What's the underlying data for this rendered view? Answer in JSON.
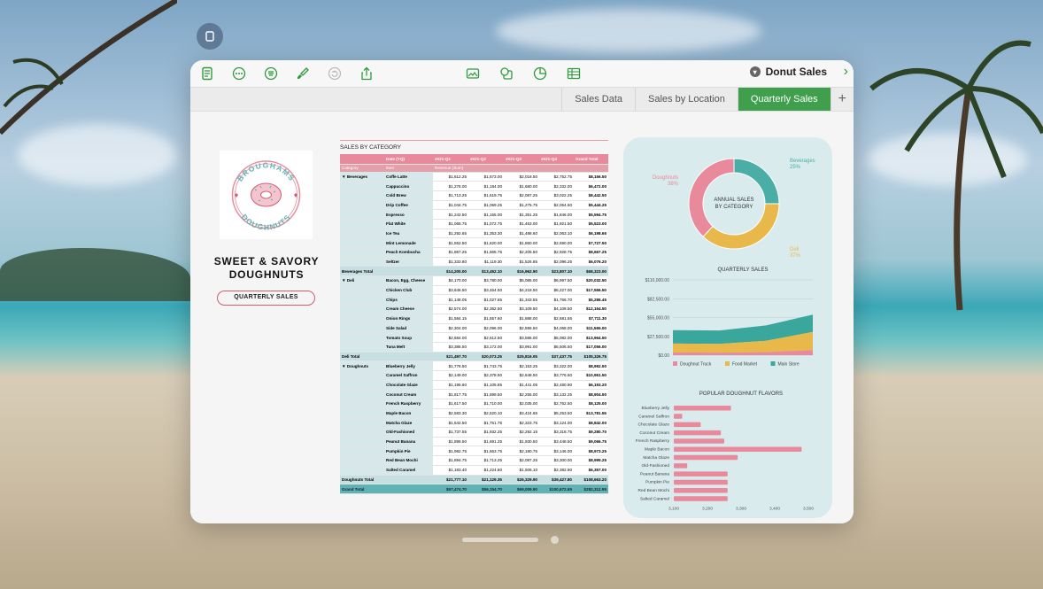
{
  "window": {
    "doc_title": "Donut Sales",
    "tabs": [
      "Sales Data",
      "Sales by Location",
      "Quarterly Sales"
    ],
    "active_tab": "Quarterly Sales",
    "accent_color": "#3f9f4c"
  },
  "toolbar_icons": [
    "document-icon",
    "more-icon",
    "format-icon",
    "brush-icon",
    "undo-icon",
    "share-icon"
  ],
  "insert_icons": [
    "media-icon",
    "shape-icon",
    "chart-icon",
    "table-icon"
  ],
  "logo": {
    "top": "BROUGHAMS",
    "bottom": "DOUGHNUTS"
  },
  "brand": {
    "line1": "SWEET & SAVORY",
    "line2": "DOUGHNUTS",
    "pill": "QUARTERLY SALES"
  },
  "table": {
    "title": "SALES BY CATEGORY",
    "header1": [
      "",
      "Date (YQ)",
      "2021-Q1",
      "2021-Q2",
      "2021-Q3",
      "2021-Q4",
      "Grand Total"
    ],
    "header2": [
      "Category",
      "Item",
      "Revenue (Sum)",
      "",
      "",
      "",
      ""
    ],
    "groups": [
      {
        "category": "▼  Beverages",
        "rows": [
          [
            "Coffe Latte",
            "$1,812.25",
            "$1,573.00",
            "$2,018.50",
            "$2,752.75",
            "$8,156.50"
          ],
          [
            "Cappuccino",
            "$1,276.00",
            "$1,184.00",
            "$1,680.00",
            "$2,332.00",
            "$6,472.00"
          ],
          [
            "Cold Brew",
            "$1,713.25",
            "$1,619.75",
            "$2,087.25",
            "$3,022.25",
            "$8,442.50"
          ],
          [
            "Drip Coffee",
            "$1,044.75",
            "$1,069.25",
            "$1,275.75",
            "$2,054.50",
            "$5,444.25"
          ],
          [
            "Espresso",
            "$1,242.50",
            "$1,155.00",
            "$1,351.25",
            "$1,846.00",
            "$5,594.75"
          ],
          [
            "Flat White",
            "$1,065.75",
            "$1,072.75",
            "$1,463.00",
            "$1,921.50",
            "$5,523.00"
          ],
          [
            "Ice Tea",
            "$1,292.65",
            "$1,353.30",
            "$1,488.60",
            "$2,063.10",
            "$6,198.65"
          ],
          [
            "Mint Lemonade",
            "$1,552.50",
            "$1,620.00",
            "$1,860.00",
            "$2,690.00",
            "$7,727.50"
          ],
          [
            "Peach Kombucha",
            "$1,867.25",
            "$1,665.75",
            "$2,205.50",
            "$2,928.75",
            "$8,667.25"
          ],
          [
            "Seltzer",
            "$1,333.80",
            "$1,119.30",
            "$1,526.85",
            "$2,096.25",
            "$6,076.20"
          ]
        ],
        "total": [
          "Beverages Total",
          "$14,200.00",
          "$13,452.10",
          "$16,962.90",
          "$23,807.10",
          "$68,323.00"
        ]
      },
      {
        "category": "▼  Deli",
        "rows": [
          [
            "Bacon, Egg, Cheese",
            "$4,170.00",
            "$3,780.00",
            "$5,085.00",
            "$6,997.50",
            "$20,032.50"
          ],
          [
            "Chicken Club",
            "$3,646.50",
            "$3,464.50",
            "$4,218.50",
            "$6,227.00",
            "$17,556.50"
          ],
          [
            "Chips",
            "$1,148.05",
            "$1,027.65",
            "$1,343.55",
            "$1,766.70",
            "$5,286.45"
          ],
          [
            "Cream Cheese",
            "$2,574.00",
            "$2,362.50",
            "$3,109.50",
            "$4,108.50",
            "$12,154.50"
          ],
          [
            "Onion Rings",
            "$1,584.15",
            "$1,557.60",
            "$1,888.00",
            "$2,681.55",
            "$7,711.30"
          ],
          [
            "Side Salad",
            "$2,304.00",
            "$2,096.00",
            "$2,596.50",
            "$4,068.00",
            "$11,565.00"
          ],
          [
            "Tomato Soup",
            "$2,684.00",
            "$2,612.50",
            "$3,586.00",
            "$5,082.00",
            "$13,964.50"
          ],
          [
            "Tuna Melt",
            "$3,386.50",
            "$3,172.00",
            "$3,991.00",
            "$6,506.50",
            "$17,056.00"
          ]
        ],
        "total": [
          "Deli Total",
          "$21,497.70",
          "$20,073.25",
          "$25,816.05",
          "$37,437.75",
          "$105,326.75"
        ]
      },
      {
        "category": "▼  Doughnuts",
        "rows": [
          [
            "Blueberry Jelly",
            "$1,776.50",
            "$1,743.75",
            "$2,153.25",
            "$3,322.00",
            "$8,992.50"
          ],
          [
            "Caramel Saffron",
            "$2,149.00",
            "$2,378.50",
            "$2,648.50",
            "$3,776.50",
            "$10,951.50"
          ],
          [
            "Chocolate Glaze",
            "$1,195.60",
            "$1,105.65",
            "$1,441.05",
            "$2,480.90",
            "$6,193.20"
          ],
          [
            "Coconut Cream",
            "$1,817.75",
            "$1,699.50",
            "$2,255.00",
            "$3,132.25",
            "$8,904.50"
          ],
          [
            "French Raspberry",
            "$1,617.50",
            "$1,710.00",
            "$2,035.00",
            "$2,762.50",
            "$8,125.00"
          ],
          [
            "Maple Bacon",
            "$2,583.30",
            "$2,520.10",
            "$3,424.65",
            "$5,253.50",
            "$13,781.55"
          ],
          [
            "Matcha Glaze",
            "$1,642.50",
            "$1,751.75",
            "$2,323.75",
            "$3,124.00",
            "$8,842.00"
          ],
          [
            "Old-Fashioned",
            "$1,737.55",
            "$1,932.25",
            "$2,292.15",
            "$3,318.75",
            "$9,280.70"
          ],
          [
            "Peanut Banana",
            "$1,896.50",
            "$1,691.25",
            "$1,930.50",
            "$3,448.50",
            "$9,066.75"
          ],
          [
            "Pumpkin Pie",
            "$1,982.75",
            "$1,663.75",
            "$2,180.75",
            "$3,146.00",
            "$8,973.25"
          ],
          [
            "Red Bean Mochi",
            "$1,894.75",
            "$1,713.25",
            "$2,087.25",
            "$3,300.00",
            "$8,995.25"
          ],
          [
            "Salted Caramel",
            "$1,183.40",
            "$1,224.60",
            "$1,506.10",
            "$2,382.90",
            "$6,357.00"
          ]
        ],
        "total": [
          "Doughnuts Total",
          "$21,777.10",
          "$21,129.35",
          "$26,329.90",
          "$39,427.80",
          "$108,663.20"
        ]
      }
    ],
    "grand": [
      "Grand Total",
      "",
      "$57,474.70",
      "$56,154.70",
      "$69,009.90",
      "$100,672.65",
      "$282,312.95"
    ]
  },
  "chart_data": [
    {
      "type": "pie",
      "title": "ANNUAL SALES BY CATEGORY",
      "categories": [
        "Beverages",
        "Deli",
        "Doughnuts"
      ],
      "values": [
        25,
        37,
        38
      ],
      "value_labels": [
        "25%",
        "37%",
        "38%"
      ],
      "colors": [
        "#4aaea6",
        "#e8b94a",
        "#e88a9b"
      ],
      "legend": "labels-outside"
    },
    {
      "type": "area",
      "title": "QUARTERLY SALES",
      "categories": [
        "2021-Q1",
        "2021-Q2",
        "2021-Q3",
        "2021-Q4"
      ],
      "series": [
        {
          "name": "Doughnut Truck",
          "values": [
            4000,
            3800,
            4500,
            7500
          ]
        },
        {
          "name": "Food Market",
          "values": [
            17000,
            16500,
            21000,
            34000
          ]
        },
        {
          "name": "Main Store",
          "values": [
            36500,
            36000,
            43500,
            59200
          ]
        }
      ],
      "stacked": true,
      "colors": [
        "#e88a9b",
        "#e8b94a",
        "#3aa79c"
      ],
      "ylim": [
        0,
        110000
      ],
      "yticks": [
        "$0.00",
        "$27,500.00",
        "$55,000.00",
        "$82,500.00",
        "$110,000.00"
      ],
      "ytick_values": [
        0,
        27500,
        55000,
        82500,
        110000
      ],
      "legend": "bottom",
      "grid": true
    },
    {
      "type": "bar",
      "orientation": "horizontal",
      "title": "POPULAR DOUGHNUT FLAVORS",
      "categories": [
        "Blueberry Jelly",
        "Caramel Saffron",
        "Chocolate Glaze",
        "Coconut Cream",
        "French Raspberry",
        "Maple Bacon",
        "Matcha Glaze",
        "Old-Fashioned",
        "Peanut Banana",
        "Pumpkin Pie",
        "Red Bean Mochi",
        "Salted Caramel"
      ],
      "values": [
        3270,
        3125,
        3180,
        3240,
        3250,
        3480,
        3290,
        3140,
        3260,
        3260,
        3260,
        3260
      ],
      "color": "#e88a9b",
      "xlim": [
        3100,
        3500
      ],
      "xticks": [
        "3,100",
        "3,200",
        "3,300",
        "3,400",
        "3,500"
      ],
      "xtick_values": [
        3100,
        3200,
        3300,
        3400,
        3500
      ],
      "grid": false
    }
  ]
}
